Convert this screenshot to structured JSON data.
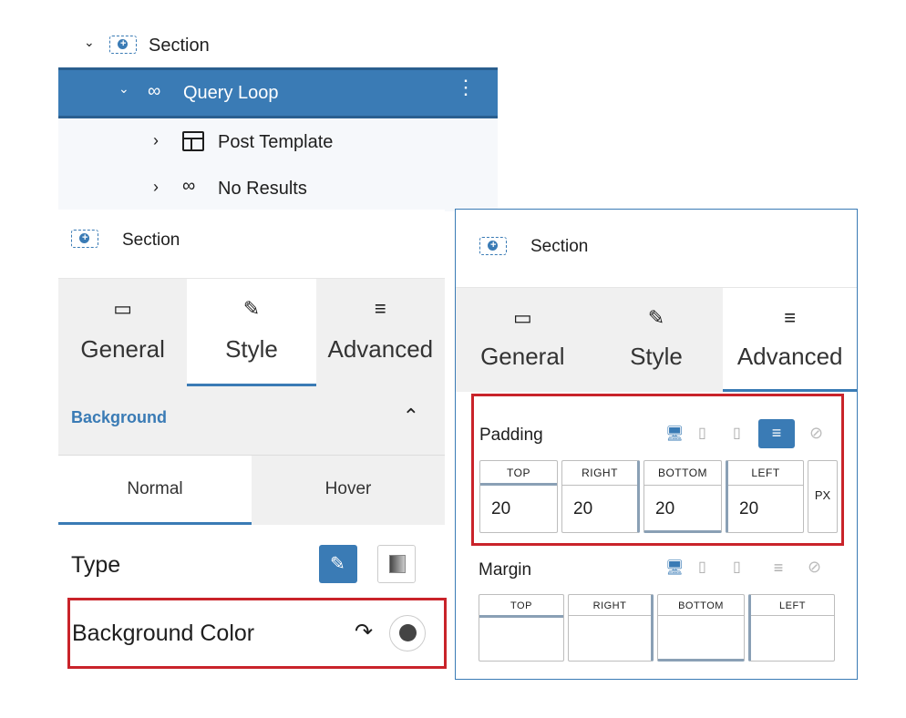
{
  "tree": {
    "items": [
      {
        "label": "Section"
      },
      {
        "label": "Query Loop"
      },
      {
        "label": "Post Template"
      },
      {
        "label": "No Results"
      }
    ]
  },
  "left_panel": {
    "title": "Section",
    "tabs": [
      {
        "label": "General"
      },
      {
        "label": "Style"
      },
      {
        "label": "Advanced"
      }
    ],
    "active_tab": "Style",
    "background": {
      "heading": "Background",
      "states": [
        {
          "label": "Normal"
        },
        {
          "label": "Hover"
        }
      ],
      "type_label": "Type",
      "color_label": "Background Color"
    }
  },
  "right_panel": {
    "title": "Section",
    "tabs": [
      {
        "label": "General"
      },
      {
        "label": "Style"
      },
      {
        "label": "Advanced"
      }
    ],
    "active_tab": "Advanced",
    "padding": {
      "label": "Padding",
      "sides": [
        {
          "caption": "TOP",
          "value": "20"
        },
        {
          "caption": "RIGHT",
          "value": "20"
        },
        {
          "caption": "BOTTOM",
          "value": "20"
        },
        {
          "caption": "LEFT",
          "value": "20"
        }
      ],
      "unit": "PX"
    },
    "margin": {
      "label": "Margin",
      "sides": [
        {
          "caption": "TOP"
        },
        {
          "caption": "RIGHT"
        },
        {
          "caption": "BOTTOM"
        },
        {
          "caption": "LEFT"
        }
      ]
    }
  },
  "colors": {
    "accent": "#3a7bb5",
    "highlight": "#c9232a"
  }
}
